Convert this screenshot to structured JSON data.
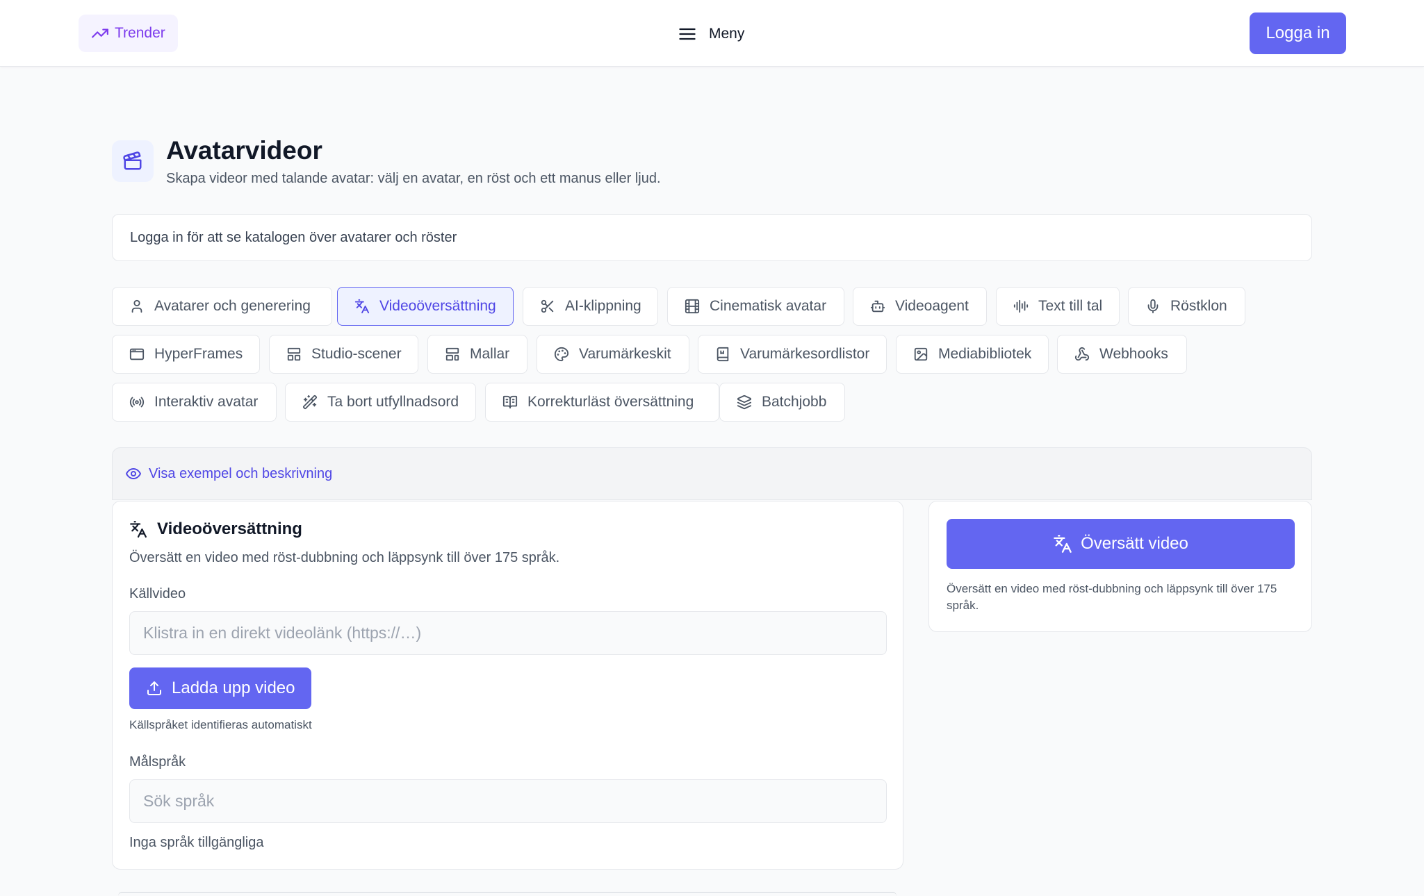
{
  "header": {
    "trend_label": "Trender",
    "menu_label": "Meny",
    "login_label": "Logga in"
  },
  "page": {
    "title": "Avatarvideor",
    "subtitle": "Skapa videor med talande avatar: välj en avatar, en röst och ett manus eller ljud.",
    "notice": "Logga in för att se katalogen över avatarer och röster"
  },
  "tabs": [
    {
      "label": "Avatarer och generering",
      "icon": "user-icon"
    },
    {
      "label": "Videoöversättning",
      "icon": "translate-icon",
      "active": true
    },
    {
      "label": "AI-klippning",
      "icon": "scissors-icon"
    },
    {
      "label": "Cinematisk avatar",
      "icon": "film-icon"
    },
    {
      "label": "Videoagent",
      "icon": "robot-icon"
    },
    {
      "label": "Text till tal",
      "icon": "audio-waveform-icon"
    },
    {
      "label": "Röstklon",
      "icon": "microphone-icon"
    },
    {
      "label": "HyperFrames",
      "icon": "browser-window-icon"
    },
    {
      "label": "Studio-scener",
      "icon": "layout-icon"
    },
    {
      "label": "Mallar",
      "icon": "template-icon"
    },
    {
      "label": "Varumärkeskit",
      "icon": "palette-icon"
    },
    {
      "label": "Varumärkesordlistor",
      "icon": "book-icon"
    },
    {
      "label": "Mediabibliotek",
      "icon": "image-icon"
    },
    {
      "label": "Webhooks",
      "icon": "webhook-icon"
    },
    {
      "label": "Interaktiv avatar",
      "icon": "broadcast-icon"
    },
    {
      "label": "Ta bort utfyllnadsord",
      "icon": "magic-wand-icon"
    },
    {
      "label": "Korrekturläst översättning",
      "icon": "book-check-icon"
    },
    {
      "label": "Batchjobb",
      "icon": "layers-icon"
    }
  ],
  "example": {
    "label": "Visa exempel och beskrivning"
  },
  "translation": {
    "title": "Videoöversättning",
    "description": "Översätt en video med röst-dubbning och läppsynk till över 175 språk.",
    "source_label": "Källvideo",
    "source_placeholder": "Klistra in en direkt videolänk (https://…)",
    "upload_label": "Ladda upp video",
    "auto_detect_hint": "Källspråket identifieras automatiskt",
    "target_label": "Målspråk",
    "language_search_placeholder": "Sök språk",
    "no_languages": "Inga språk tillgängliga"
  },
  "action": {
    "translate_label": "Översätt video",
    "description": "Översätt en video med röst-dubbning och läppsynk till över 175 språk."
  },
  "colors": {
    "accent": "#6366f1",
    "accent_text": "#4f46e5",
    "trend_text": "#7c3aed",
    "background": "#f9fafb"
  }
}
